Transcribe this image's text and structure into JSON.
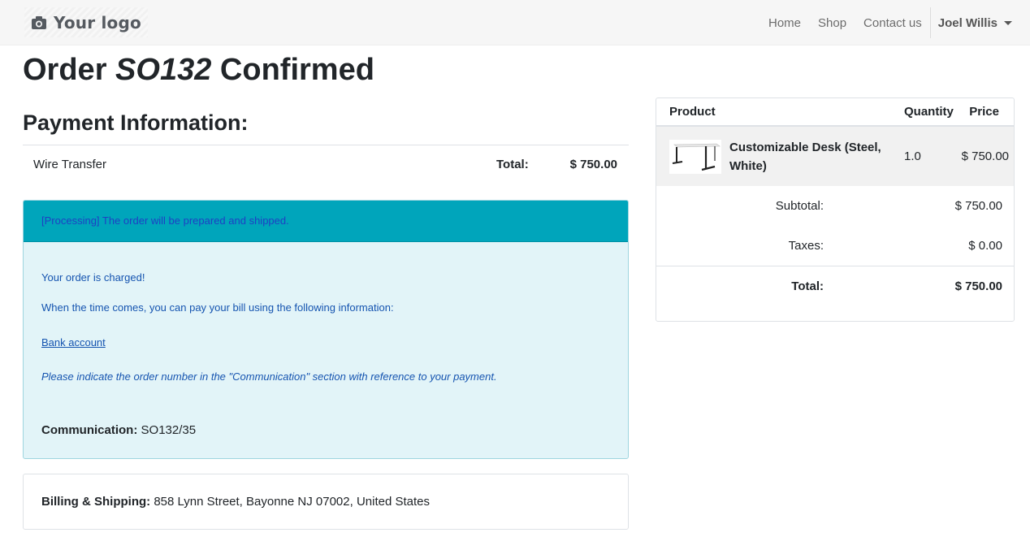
{
  "navbar": {
    "logo_text": "Your logo",
    "links": [
      "Home",
      "Shop",
      "Contact us"
    ],
    "user_name": "Joel Willis"
  },
  "order": {
    "title_prefix": "Order",
    "number": "SO132",
    "title_suffix": "Confirmed"
  },
  "payment": {
    "heading": "Payment Information:",
    "method": "Wire Transfer",
    "total_label": "Total:",
    "total_value": "$ 750.00"
  },
  "info_card": {
    "status": "[Processing] The order will be prepared and shipped.",
    "charged": "Your order is charged!",
    "pay_info": "When the time comes, you can pay your bill using the following information:",
    "bank_link": "Bank account",
    "note": "Please indicate the order number in the \"Communication\" section with reference to your payment.",
    "communication_label": "Communication:",
    "communication_value": "SO132/35"
  },
  "address": {
    "label": "Billing & Shipping:",
    "value": "858 Lynn Street, Bayonne NJ 07002, United States"
  },
  "summary": {
    "headers": {
      "product": "Product",
      "quantity": "Quantity",
      "price": "Price"
    },
    "lines": [
      {
        "name": "Customizable Desk (Steel, White)",
        "quantity": "1.0",
        "price": "$ 750.00"
      }
    ],
    "subtotal_label": "Subtotal:",
    "subtotal_value": "$ 750.00",
    "taxes_label": "Taxes:",
    "taxes_value": "$ 0.00",
    "total_label": "Total:",
    "total_value": "$ 750.00"
  },
  "colors": {
    "info_header": "#00a5bb",
    "info_body": "#e2f4f8",
    "info_text": "#1554b0"
  }
}
